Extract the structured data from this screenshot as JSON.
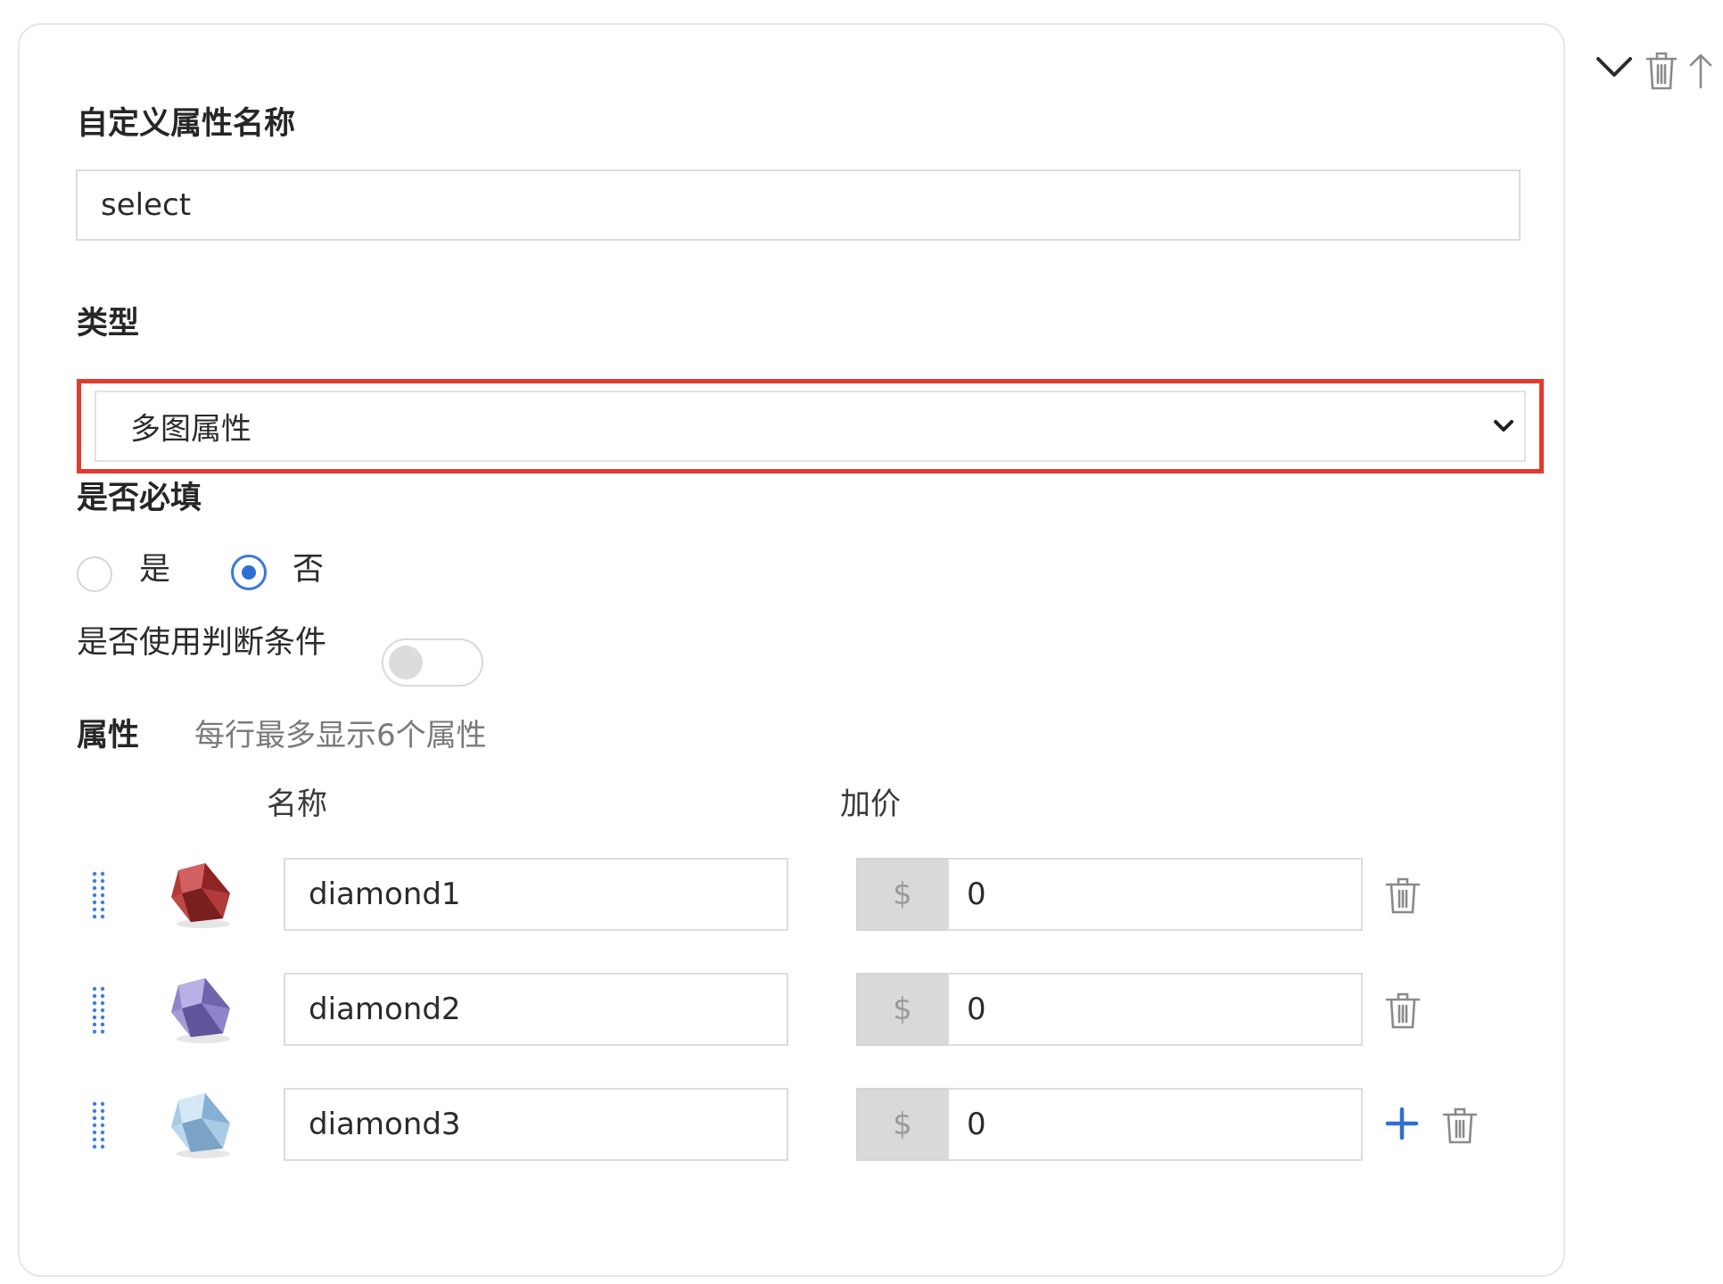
{
  "custom_attr": {
    "label": "自定义属性名称",
    "value": "select"
  },
  "type_field": {
    "label": "类型",
    "selected": "多图属性"
  },
  "required": {
    "label": "是否必填",
    "options": [
      "是",
      "否"
    ],
    "selected": "否"
  },
  "condition": {
    "label": "是否使用判断条件",
    "enabled": false
  },
  "attributes": {
    "label": "属性",
    "hint": "每行最多显示6个属性",
    "col_name": "名称",
    "col_price": "加价",
    "currency": "$",
    "rows": [
      {
        "name": "diamond1",
        "price": "0",
        "gem_color": "#b23a3a"
      },
      {
        "name": "diamond2",
        "price": "0",
        "gem_color": "#8f84c9"
      },
      {
        "name": "diamond3",
        "price": "0",
        "gem_color": "#a9cbe6"
      }
    ]
  },
  "colors": {
    "accent": "#2f6fd4",
    "highlight_border": "#e23b2e"
  },
  "icons": {
    "collapse": "chevron-down-icon",
    "delete": "trash-icon",
    "move_up": "arrow-up-icon",
    "add": "plus-icon",
    "drag": "drag-handle-icon"
  }
}
